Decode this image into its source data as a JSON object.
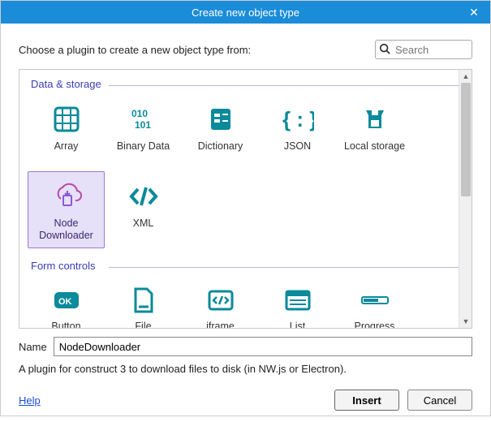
{
  "dialog": {
    "title": "Create new object type",
    "prompt": "Choose a plugin to create a new object type from:",
    "search_placeholder": "Search",
    "name_label": "Name",
    "name_value": "NodeDownloader",
    "description": "A plugin for construct 3 to download files to disk (in NW.js or Electron).",
    "help_label": "Help",
    "insert_label": "Insert",
    "cancel_label": "Cancel"
  },
  "sections": [
    {
      "title": "Data & storage",
      "items": [
        {
          "label": "Array",
          "icon": "array"
        },
        {
          "label": "Binary Data",
          "icon": "binary"
        },
        {
          "label": "Dictionary",
          "icon": "dictionary"
        },
        {
          "label": "JSON",
          "icon": "json"
        },
        {
          "label": "Local storage",
          "icon": "localstorage"
        },
        {
          "label": "Node Downloader",
          "icon": "nodedownloader",
          "selected": true
        },
        {
          "label": "XML",
          "icon": "xml"
        }
      ]
    },
    {
      "title": "Form controls",
      "items": [
        {
          "label": "Button",
          "icon": "button"
        },
        {
          "label": "File",
          "icon": "file"
        },
        {
          "label": "iframe",
          "icon": "iframe"
        },
        {
          "label": "List",
          "icon": "list"
        },
        {
          "label": "Progress",
          "icon": "progress"
        }
      ]
    }
  ],
  "colors": {
    "accent": "#0a8a9a",
    "selected_bg": "#e6e0f8",
    "selected_border": "#9a7bd8",
    "link": "#1a4bd8",
    "section": "#3b3bb8"
  }
}
